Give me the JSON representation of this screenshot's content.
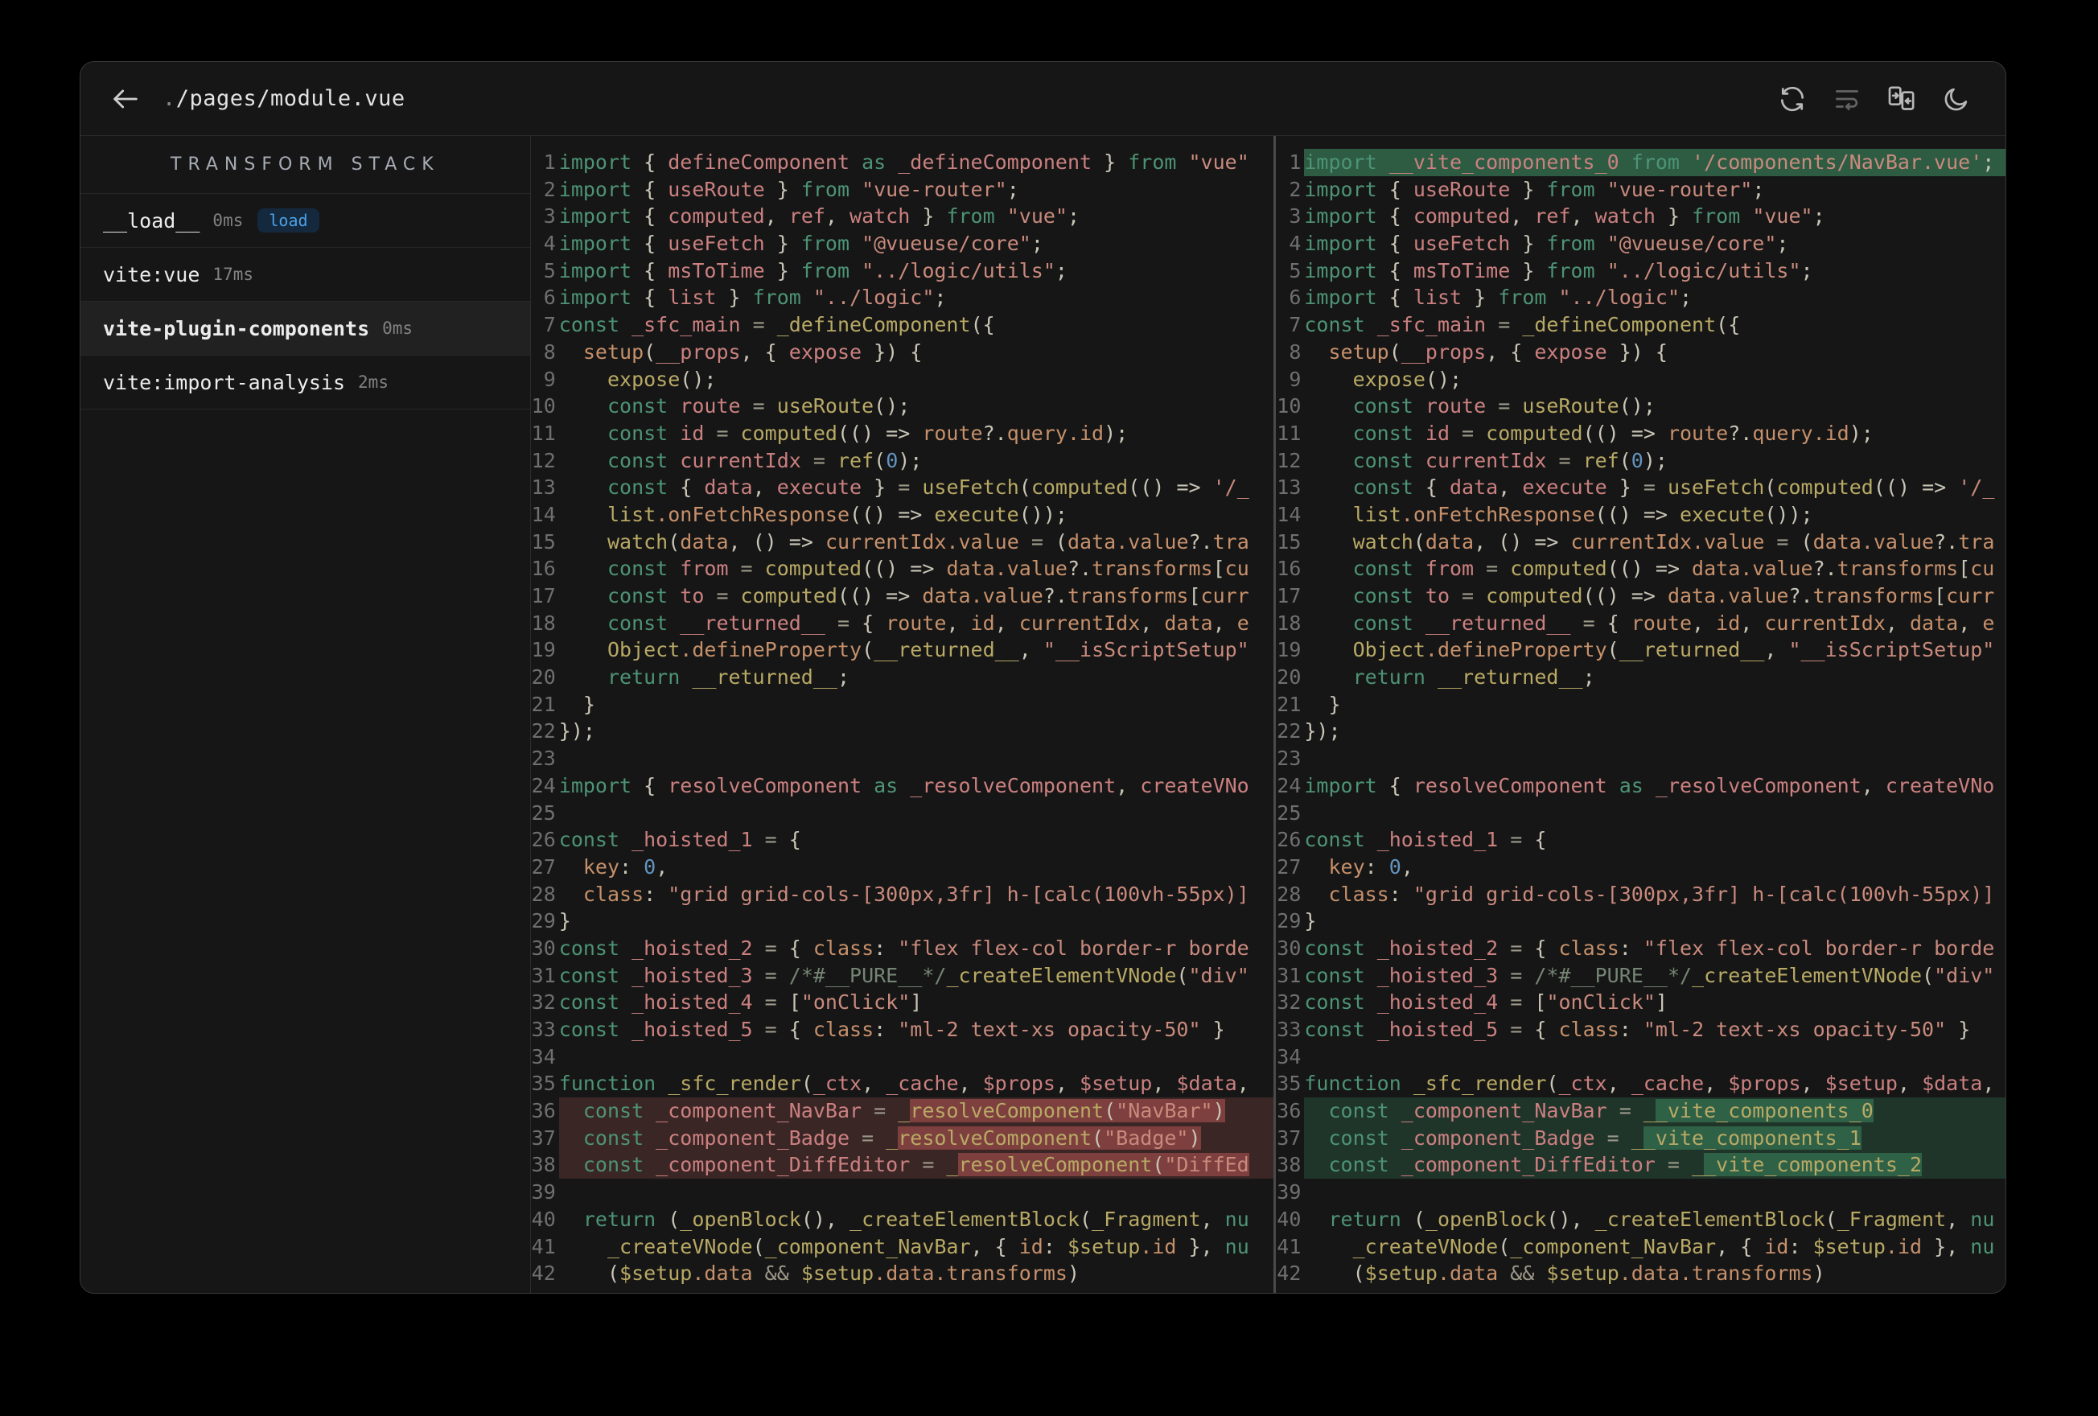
{
  "header": {
    "title_prefix": ".",
    "title_path": "/pages/module.vue",
    "icons": [
      "refresh",
      "line-wrap",
      "side-by-side-diff",
      "dark-mode-toggle"
    ]
  },
  "sidebar": {
    "title": "TRANSFORM STACK",
    "items": [
      {
        "name": "__load__",
        "time": "0ms",
        "badge": "load",
        "selected": false
      },
      {
        "name": "vite:vue",
        "time": "17ms",
        "badge": null,
        "selected": false
      },
      {
        "name": "vite-plugin-components",
        "time": "0ms",
        "badge": null,
        "selected": true
      },
      {
        "name": "vite:import-analysis",
        "time": "2ms",
        "badge": null,
        "selected": false
      }
    ]
  },
  "colors": {
    "keyword": "#4d9375",
    "declaration": "#cb8080",
    "function": "#b8a965",
    "variable": "#c6906b",
    "string": "#c98a7d",
    "number": "#6394bf",
    "punctuation": "#c9c5b6",
    "operator": "#9c9989",
    "comment": "#758575",
    "diff_del_line": "#3b2626",
    "diff_del_word": "#7e403e",
    "diff_add_line": "#20352a",
    "diff_add_word": "#2f6146",
    "diff_add_full": "#2d5c43",
    "badge_text": "#4da1e8",
    "badge_bg": "#14293d"
  },
  "code": {
    "line_count": 42,
    "common_lines": {
      "2": [
        [
          "k",
          "import"
        ],
        [
          "p",
          " { "
        ],
        [
          "d",
          "useRoute"
        ],
        [
          "p",
          " } "
        ],
        [
          "k",
          "from"
        ],
        [
          "s",
          " \"vue-router\""
        ],
        [
          "p",
          ";"
        ]
      ],
      "3": [
        [
          "k",
          "import"
        ],
        [
          "p",
          " { "
        ],
        [
          "d",
          "computed"
        ],
        [
          "p",
          ", "
        ],
        [
          "d",
          "ref"
        ],
        [
          "p",
          ", "
        ],
        [
          "d",
          "watch"
        ],
        [
          "p",
          " } "
        ],
        [
          "k",
          "from"
        ],
        [
          "s",
          " \"vue\""
        ],
        [
          "p",
          ";"
        ]
      ],
      "4": [
        [
          "k",
          "import"
        ],
        [
          "p",
          " { "
        ],
        [
          "d",
          "useFetch"
        ],
        [
          "p",
          " } "
        ],
        [
          "k",
          "from"
        ],
        [
          "s",
          " \"@vueuse/core\""
        ],
        [
          "p",
          ";"
        ]
      ],
      "5": [
        [
          "k",
          "import"
        ],
        [
          "p",
          " { "
        ],
        [
          "d",
          "msToTime"
        ],
        [
          "p",
          " } "
        ],
        [
          "k",
          "from"
        ],
        [
          "s",
          " \"../logic/utils\""
        ],
        [
          "p",
          ";"
        ]
      ],
      "6": [
        [
          "k",
          "import"
        ],
        [
          "p",
          " { "
        ],
        [
          "d",
          "list"
        ],
        [
          "p",
          " } "
        ],
        [
          "k",
          "from"
        ],
        [
          "s",
          " \"../logic\""
        ],
        [
          "p",
          ";"
        ]
      ],
      "7": [
        [
          "k",
          "const"
        ],
        [
          "d",
          " _sfc_main"
        ],
        [
          "o",
          " = "
        ],
        [
          "f",
          "_defineComponent"
        ],
        [
          "p",
          "({"
        ]
      ],
      "8": [
        [
          "v",
          "  setup"
        ],
        [
          "p",
          "("
        ],
        [
          "d",
          "__props"
        ],
        [
          "p",
          ", { "
        ],
        [
          "d",
          "expose"
        ],
        [
          "p",
          " }) {"
        ]
      ],
      "9": [
        [
          "f",
          "    expose"
        ],
        [
          "p",
          "();"
        ]
      ],
      "10": [
        [
          "k",
          "    const"
        ],
        [
          "d",
          " route"
        ],
        [
          "o",
          " = "
        ],
        [
          "f",
          "useRoute"
        ],
        [
          "p",
          "();"
        ]
      ],
      "11": [
        [
          "k",
          "    const"
        ],
        [
          "d",
          " id"
        ],
        [
          "o",
          " = "
        ],
        [
          "f",
          "computed"
        ],
        [
          "p",
          "(() => "
        ],
        [
          "v",
          "route"
        ],
        [
          "p",
          "?."
        ],
        [
          "v",
          "query.id"
        ],
        [
          "p",
          ");"
        ]
      ],
      "12": [
        [
          "k",
          "    const"
        ],
        [
          "d",
          " currentIdx"
        ],
        [
          "o",
          " = "
        ],
        [
          "f",
          "ref"
        ],
        [
          "p",
          "("
        ],
        [
          "n",
          "0"
        ],
        [
          "p",
          ");"
        ]
      ],
      "13": [
        [
          "k",
          "    const"
        ],
        [
          "p",
          " { "
        ],
        [
          "d",
          "data"
        ],
        [
          "p",
          ", "
        ],
        [
          "d",
          "execute"
        ],
        [
          "p",
          " } "
        ],
        [
          "o",
          "= "
        ],
        [
          "f",
          "useFetch"
        ],
        [
          "p",
          "("
        ],
        [
          "f",
          "computed"
        ],
        [
          "p",
          "(() => "
        ],
        [
          "s",
          "'/_"
        ]
      ],
      "14": [
        [
          "f",
          "    list"
        ],
        [
          "v",
          ".onFetchResponse"
        ],
        [
          "p",
          "(() => "
        ],
        [
          "f",
          "execute"
        ],
        [
          "p",
          "());"
        ]
      ],
      "15": [
        [
          "f",
          "    watch"
        ],
        [
          "p",
          "("
        ],
        [
          "v",
          "data"
        ],
        [
          "p",
          ", () => "
        ],
        [
          "v",
          "currentIdx.value"
        ],
        [
          "o",
          " = "
        ],
        [
          "p",
          "("
        ],
        [
          "v",
          "data.value"
        ],
        [
          "p",
          "?."
        ],
        [
          "v",
          "tra"
        ]
      ],
      "16": [
        [
          "k",
          "    const"
        ],
        [
          "d",
          " from"
        ],
        [
          "o",
          " = "
        ],
        [
          "f",
          "computed"
        ],
        [
          "p",
          "(() => "
        ],
        [
          "v",
          "data.value"
        ],
        [
          "p",
          "?."
        ],
        [
          "v",
          "transforms"
        ],
        [
          "p",
          "["
        ],
        [
          "v",
          "cu"
        ]
      ],
      "17": [
        [
          "k",
          "    const"
        ],
        [
          "d",
          " to"
        ],
        [
          "o",
          " = "
        ],
        [
          "f",
          "computed"
        ],
        [
          "p",
          "(() => "
        ],
        [
          "v",
          "data.value"
        ],
        [
          "p",
          "?."
        ],
        [
          "v",
          "transforms"
        ],
        [
          "p",
          "["
        ],
        [
          "v",
          "curr"
        ]
      ],
      "18": [
        [
          "k",
          "    const"
        ],
        [
          "d",
          " __returned__"
        ],
        [
          "o",
          " = "
        ],
        [
          "p",
          "{ "
        ],
        [
          "v",
          "route"
        ],
        [
          "p",
          ", "
        ],
        [
          "v",
          "id"
        ],
        [
          "p",
          ", "
        ],
        [
          "v",
          "currentIdx"
        ],
        [
          "p",
          ", "
        ],
        [
          "v",
          "data"
        ],
        [
          "p",
          ", "
        ],
        [
          "v",
          "e"
        ]
      ],
      "19": [
        [
          "f",
          "    Object"
        ],
        [
          "v",
          ".defineProperty"
        ],
        [
          "p",
          "("
        ],
        [
          "f",
          "__returned__"
        ],
        [
          "p",
          ", "
        ],
        [
          "s",
          "\"__isScriptSetup\""
        ]
      ],
      "20": [
        [
          "k",
          "    return"
        ],
        [
          "f",
          " __returned__"
        ],
        [
          "p",
          ";"
        ]
      ],
      "21": [
        [
          "p",
          "  }"
        ]
      ],
      "22": [
        [
          "p",
          "});"
        ]
      ],
      "23": [],
      "24": [
        [
          "k",
          "import"
        ],
        [
          "p",
          " { "
        ],
        [
          "d",
          "resolveComponent"
        ],
        [
          "k",
          " as "
        ],
        [
          "d",
          "_resolveComponent"
        ],
        [
          "p",
          ", "
        ],
        [
          "d",
          "createVNo"
        ]
      ],
      "25": [],
      "26": [
        [
          "k",
          "const"
        ],
        [
          "d",
          " _hoisted_1"
        ],
        [
          "o",
          " = "
        ],
        [
          "p",
          "{"
        ]
      ],
      "27": [
        [
          "v",
          "  key"
        ],
        [
          "p",
          ": "
        ],
        [
          "n",
          "0"
        ],
        [
          "p",
          ","
        ]
      ],
      "28": [
        [
          "v",
          "  class"
        ],
        [
          "p",
          ": "
        ],
        [
          "s",
          "\"grid grid-cols-[300px,3fr] h-[calc(100vh-55px)]"
        ]
      ],
      "29": [
        [
          "p",
          "}"
        ]
      ],
      "30": [
        [
          "k",
          "const"
        ],
        [
          "d",
          " _hoisted_2"
        ],
        [
          "o",
          " = "
        ],
        [
          "p",
          "{ "
        ],
        [
          "v",
          "class"
        ],
        [
          "p",
          ": "
        ],
        [
          "s",
          "\"flex flex-col border-r borde"
        ]
      ],
      "31": [
        [
          "k",
          "const"
        ],
        [
          "d",
          " _hoisted_3"
        ],
        [
          "o",
          " = "
        ],
        [
          "c",
          "/*#__PURE__*/"
        ],
        [
          "f",
          "_createElementVNode"
        ],
        [
          "p",
          "("
        ],
        [
          "s",
          "\"div\""
        ]
      ],
      "32": [
        [
          "k",
          "const"
        ],
        [
          "d",
          " _hoisted_4"
        ],
        [
          "o",
          " = "
        ],
        [
          "p",
          "["
        ],
        [
          "s",
          "\"onClick\""
        ],
        [
          "p",
          "]"
        ]
      ],
      "33": [
        [
          "k",
          "const"
        ],
        [
          "d",
          " _hoisted_5"
        ],
        [
          "o",
          " = "
        ],
        [
          "p",
          "{ "
        ],
        [
          "v",
          "class"
        ],
        [
          "p",
          ": "
        ],
        [
          "s",
          "\"ml-2 text-xs opacity-50\""
        ],
        [
          "p",
          " }"
        ]
      ],
      "34": [],
      "35": [
        [
          "k",
          "function"
        ],
        [
          "f",
          " _sfc_render"
        ],
        [
          "p",
          "("
        ],
        [
          "d",
          "_ctx"
        ],
        [
          "p",
          ", "
        ],
        [
          "d",
          "_cache"
        ],
        [
          "p",
          ", "
        ],
        [
          "d",
          "$props"
        ],
        [
          "p",
          ", "
        ],
        [
          "d",
          "$setup"
        ],
        [
          "p",
          ", "
        ],
        [
          "d",
          "$data"
        ],
        [
          "p",
          ","
        ]
      ],
      "39": [],
      "40": [
        [
          "k",
          "  return"
        ],
        [
          "p",
          " ("
        ],
        [
          "f",
          "_openBlock"
        ],
        [
          "p",
          "(), "
        ],
        [
          "f",
          "_createElementBlock"
        ],
        [
          "p",
          "("
        ],
        [
          "f",
          "_Fragment"
        ],
        [
          "p",
          ", "
        ],
        [
          "k",
          "nu"
        ]
      ],
      "41": [
        [
          "f",
          "    _createVNode"
        ],
        [
          "p",
          "("
        ],
        [
          "f",
          "_component_NavBar"
        ],
        [
          "p",
          ", { "
        ],
        [
          "v",
          "id"
        ],
        [
          "p",
          ": "
        ],
        [
          "f",
          "$setup"
        ],
        [
          "v",
          ".id"
        ],
        [
          "p",
          " }, "
        ],
        [
          "k",
          "nu"
        ]
      ],
      "42": [
        [
          "p",
          "    ("
        ],
        [
          "f",
          "$setup"
        ],
        [
          "v",
          ".data"
        ],
        [
          "o",
          " && "
        ],
        [
          "f",
          "$setup"
        ],
        [
          "v",
          ".data.transforms"
        ],
        [
          "p",
          ")"
        ]
      ]
    },
    "left_overrides": {
      "1": {
        "cls": null,
        "t": [
          [
            "k",
            "import"
          ],
          [
            "p",
            " { "
          ],
          [
            "d",
            "defineComponent"
          ],
          [
            "k",
            " as "
          ],
          [
            "d",
            "_defineComponent"
          ],
          [
            "p",
            " } "
          ],
          [
            "k",
            "from"
          ],
          [
            "s",
            " \"vue\""
          ]
        ]
      },
      "36": {
        "cls": "del",
        "t": [
          [
            "k",
            "  const"
          ],
          [
            "d",
            " _component_NavBar"
          ],
          [
            "o",
            " = "
          ],
          [
            "f",
            "_"
          ],
          [
            "f hr",
            "resolveComponent"
          ],
          [
            "p hr",
            "("
          ],
          [
            "s hr",
            "\"NavBar\""
          ],
          [
            "p hr",
            ")"
          ]
        ]
      },
      "37": {
        "cls": "del",
        "t": [
          [
            "k",
            "  const"
          ],
          [
            "d",
            " _component_Badge"
          ],
          [
            "o",
            " = "
          ],
          [
            "f",
            "_"
          ],
          [
            "f hr",
            "resolveComponent"
          ],
          [
            "p hr",
            "("
          ],
          [
            "s hr",
            "\"Badge\""
          ],
          [
            "p hr",
            ")"
          ]
        ]
      },
      "38": {
        "cls": "del",
        "t": [
          [
            "k",
            "  const"
          ],
          [
            "d",
            " _component_DiffEditor"
          ],
          [
            "o",
            " = "
          ],
          [
            "f",
            "_"
          ],
          [
            "f hr",
            "resolveComponent"
          ],
          [
            "p hr",
            "("
          ],
          [
            "s hr",
            "\"DiffEd"
          ]
        ]
      }
    },
    "right_overrides": {
      "1": {
        "cls": "addfull",
        "t": [
          [
            "k",
            "import"
          ],
          [
            "d",
            " __vite_components_0"
          ],
          [
            "k",
            " from"
          ],
          [
            "s",
            " '/components/NavBar.vue'"
          ],
          [
            "p",
            ";"
          ]
        ]
      },
      "36": {
        "cls": "add",
        "t": [
          [
            "k",
            "  const"
          ],
          [
            "d",
            " _component_NavBar"
          ],
          [
            "o",
            " = "
          ],
          [
            "f",
            "_"
          ],
          [
            "f hg",
            "_vite_components_0"
          ]
        ]
      },
      "37": {
        "cls": "add",
        "t": [
          [
            "k",
            "  const"
          ],
          [
            "d",
            " _component_Badge"
          ],
          [
            "o",
            " = "
          ],
          [
            "f",
            "_"
          ],
          [
            "f hg",
            "_vite_components_1"
          ]
        ]
      },
      "38": {
        "cls": "add",
        "t": [
          [
            "k",
            "  const"
          ],
          [
            "d",
            " _component_DiffEditor"
          ],
          [
            "o",
            " = "
          ],
          [
            "f",
            "_"
          ],
          [
            "f hg",
            "_vite_components_2"
          ]
        ]
      }
    }
  }
}
